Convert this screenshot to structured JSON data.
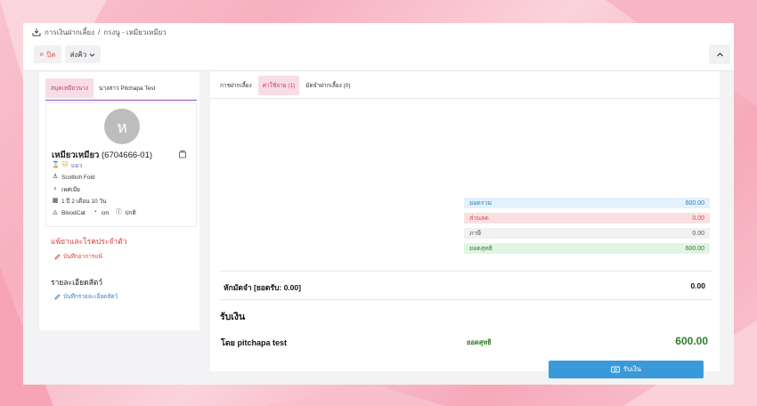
{
  "colors": {
    "accent_pink": "#c33b5e",
    "tab_active_bg": "#f8dde6",
    "primary_blue": "#3a9ad9",
    "success_green": "#2d7a2d",
    "danger_red": "#e05a5a",
    "tab_underline": "#8e4fbf"
  },
  "breadcrumb": {
    "icon": "download-tray-icon",
    "part1": "การเงินฝากเลี้ยง",
    "sep": "/",
    "part2": "กรงนู - เหมียวเหมียว"
  },
  "toolbar": {
    "close_label": "ปิด",
    "close_icon": "×",
    "send_label": "ส่งคิว",
    "send_icon": "chevron-down-icon"
  },
  "left_tabs": [
    {
      "label": "สมุดเหมียวนาง"
    },
    {
      "label": "นางสาว Pitchapa Test"
    }
  ],
  "pet": {
    "avatar_letter": "ห",
    "name": "เหมียวเหมียว",
    "code": "(6704666-01)",
    "species": "แมว",
    "breed": "Scottish Fold",
    "sex": "เพศเมีย",
    "age": "1 ปี 2 เดือน 10 วัน",
    "blood": "BloodCat",
    "weight": "cm",
    "ref": "ปกติ"
  },
  "allergy_section": {
    "title": "แพ้ยาและโรคประจำตัว",
    "link": "บันทึกอาการแพ้"
  },
  "detail_section": {
    "title": "รายละเอียดสัตว์",
    "link": "บันทึกรายละเอียดสัตว์"
  },
  "right_tabs": [
    {
      "label": "การฝากเลี้ยง"
    },
    {
      "label": "ค่าใช้จ่าย (1)"
    },
    {
      "label": "มัดจำฝากเลี้ยง (0)"
    }
  ],
  "summary": [
    {
      "label": "ยอดรวม",
      "value": "600.00",
      "bg": "#e3f1fb",
      "color": "#2e7fb8"
    },
    {
      "label": "ส่วนลด",
      "value": "0.00",
      "bg": "#fbe0e2",
      "color": "#d04a55"
    },
    {
      "label": "ภาษี",
      "value": "0.00",
      "bg": "#f1f1f3",
      "color": "#555555"
    },
    {
      "label": "ยอดสุทธิ",
      "value": "600.00",
      "bg": "#e2f4e3",
      "color": "#2d7a2d"
    }
  ],
  "deposit": {
    "label": "หักมัดจำ [ยอดรับ: 0.00]",
    "value": "0.00"
  },
  "receive": {
    "title": "รับเงิน",
    "payer": "โดย pitchapa test",
    "net_label": "ยอดสุทธิ",
    "net_value": "600.00",
    "button": "รับเงิน"
  }
}
